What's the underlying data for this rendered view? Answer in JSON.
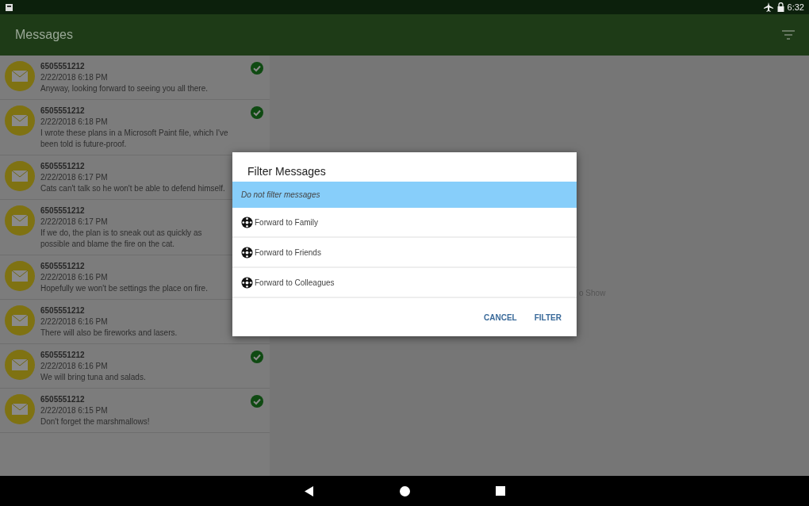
{
  "status_bar": {
    "time": "6:32"
  },
  "app_bar": {
    "title": "Messages"
  },
  "messages": [
    {
      "sender": "6505551212",
      "date": "2/22/2018 6:18 PM",
      "text": "Anyway, looking forward to seeing you all there.",
      "read": true
    },
    {
      "sender": "6505551212",
      "date": "2/22/2018 6:18 PM",
      "text": "I wrote these plans in a Microsoft Paint file, which I've been told is future-proof.",
      "read": true
    },
    {
      "sender": "6505551212",
      "date": "2/22/2018 6:17 PM",
      "text": "Cats can't talk so he won't be able to defend himself."
    },
    {
      "sender": "6505551212",
      "date": "2/22/2018 6:17 PM",
      "text": "If we do, the plan is to sneak out as quickly as possible and blame the fire on the cat."
    },
    {
      "sender": "6505551212",
      "date": "2/22/2018 6:16 PM",
      "text": "Hopefully we won't be settings the place on fire."
    },
    {
      "sender": "6505551212",
      "date": "2/22/2018 6:16 PM",
      "text": "There will also be fireworks and lasers."
    },
    {
      "sender": "6505551212",
      "date": "2/22/2018 6:16 PM",
      "text": "We will bring tuna and salads.",
      "read": true
    },
    {
      "sender": "6505551212",
      "date": "2/22/2018 6:15 PM",
      "text": "Don't forget the marshmallows!",
      "read": true
    }
  ],
  "detail_pane": {
    "text": "o Show"
  },
  "dialog": {
    "title": "Filter Messages",
    "options": [
      {
        "label": "Do not filter messages",
        "selected": true,
        "kind": "plain"
      },
      {
        "label": "Forward to Family",
        "selected": false,
        "kind": "group"
      },
      {
        "label": "Forward to Friends",
        "selected": false,
        "kind": "group"
      },
      {
        "label": "Forward to Colleagues",
        "selected": false,
        "kind": "group"
      }
    ],
    "buttons": [
      "CANCEL",
      "FILTER"
    ]
  }
}
